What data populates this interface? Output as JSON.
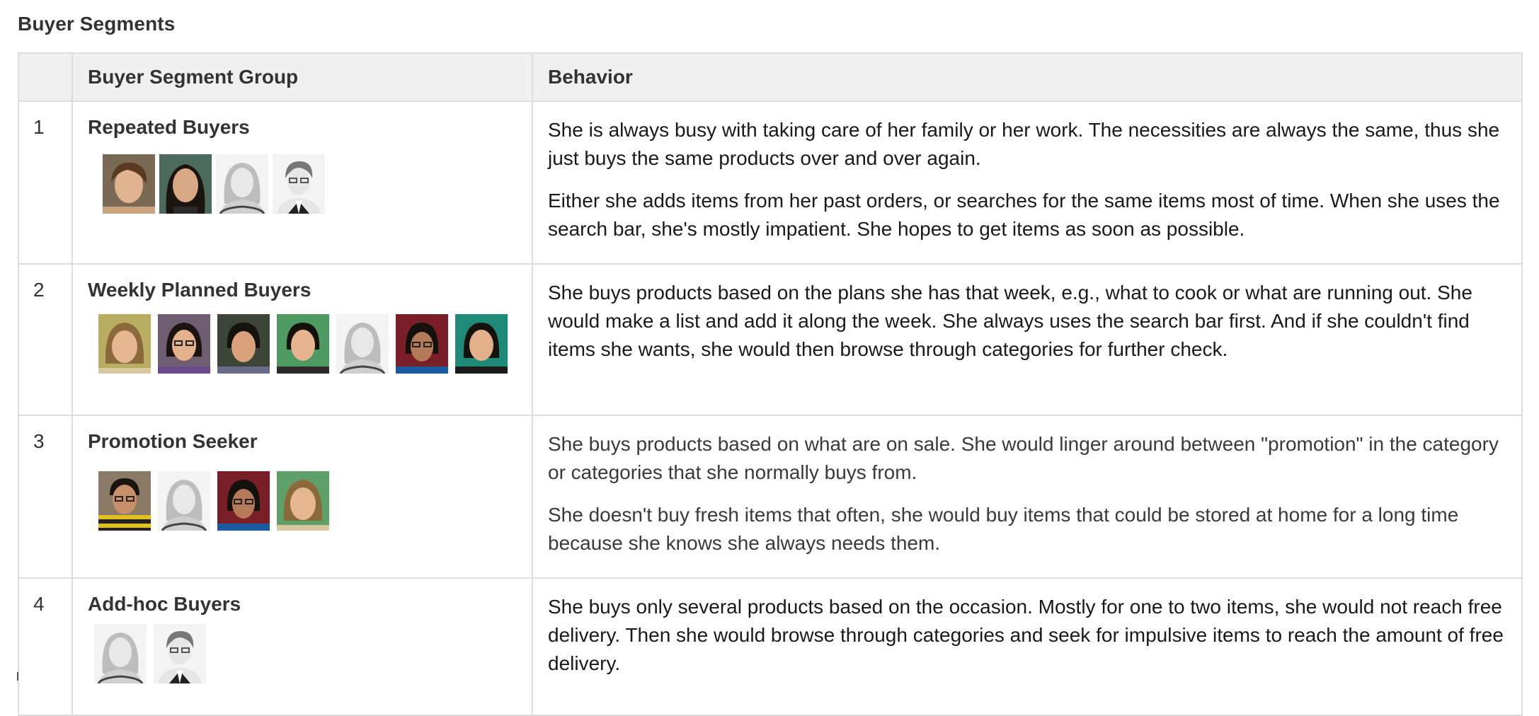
{
  "page": {
    "title": "Buyer Segments"
  },
  "table": {
    "headers": [
      "",
      "Buyer Segment Group",
      "Behavior"
    ],
    "rows": [
      {
        "num": "1",
        "group": "Repeated Buyers",
        "avatars": [
          "photo-woman-brown-hair",
          "photo-woman-dark-hair",
          "placeholder-female",
          "placeholder-male"
        ],
        "behavior": [
          "She is always busy with taking care of her family or her work. The necessities are always the same, thus she just buys the same products over and over again.",
          "Either she adds items from her past orders, or searches for the same items most of time. When she uses the search bar, she's mostly impatient. She hopes to get items as soon as possible."
        ]
      },
      {
        "num": "2",
        "group": "Weekly Planned Buyers",
        "avatars": [
          "photo-woman-1",
          "photo-woman-glasses",
          "photo-woman-short-hair",
          "photo-woman-green-bg",
          "placeholder-female",
          "photo-woman-red-bg",
          "photo-woman-teal-bg"
        ],
        "behavior": [
          "She buys products based on the plans she has that week, e.g., what to cook or what are running out. She would make a list and add it along the week. She always uses the search bar first. And if she couldn't find items she wants, she would then browse through categories for further check."
        ]
      },
      {
        "num": "3",
        "group": "Promotion Seeker",
        "avatars": [
          "photo-man-striped-shirt",
          "placeholder-female",
          "photo-woman-glasses-red-bg",
          "photo-woman-green-bg"
        ],
        "behavior": [
          "She buys products based on what are on sale. She would linger around between \"promotion\" in the category or categories that she normally buys from.",
          "She doesn't buy fresh items that often, she would buy items that could be stored at home for a long time because she knows she always needs them."
        ]
      },
      {
        "num": "4",
        "group": "Add-hoc Buyers",
        "avatars": [
          "placeholder-female",
          "placeholder-male"
        ],
        "behavior": [
          "She buys only several products based on the occasion. Mostly for one to two items, she would not reach free delivery. Then she would browse through categories and seek for impulsive items to reach the amount of free delivery."
        ]
      }
    ]
  }
}
